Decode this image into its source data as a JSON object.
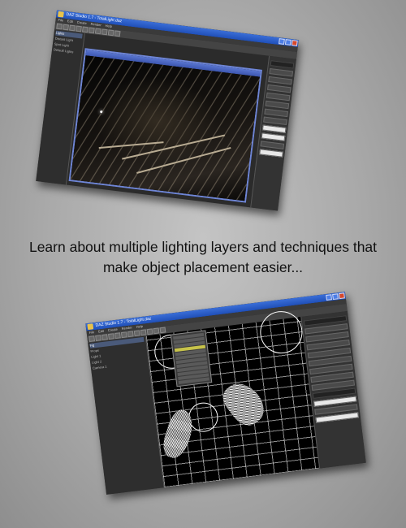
{
  "caption": {
    "line1": "Learn about multiple lighting layers and techniques that",
    "line2": "make object placement easier..."
  },
  "screenshot_top": {
    "title": "DAZ Studio 1.7 - TotalLight.daz",
    "menu": [
      "File",
      "Edit",
      "Create",
      "Render",
      "Help"
    ],
    "tree": [
      "Lights",
      "Distant Light",
      "Spot Light",
      "Default Lights"
    ]
  },
  "screenshot_bottom": {
    "title": "DAZ Studio 1.7 - TotalLight.daz",
    "menu": [
      "File",
      "Edit",
      "Create",
      "Render",
      "Help"
    ],
    "tree": [
      "Fig",
      "Props",
      "Light 1",
      "Light 2",
      "Camera 1"
    ]
  },
  "colors": {
    "titlebar": "#1f4fb8",
    "highlight": "#c7c34a",
    "background": "#b4b4b4"
  }
}
